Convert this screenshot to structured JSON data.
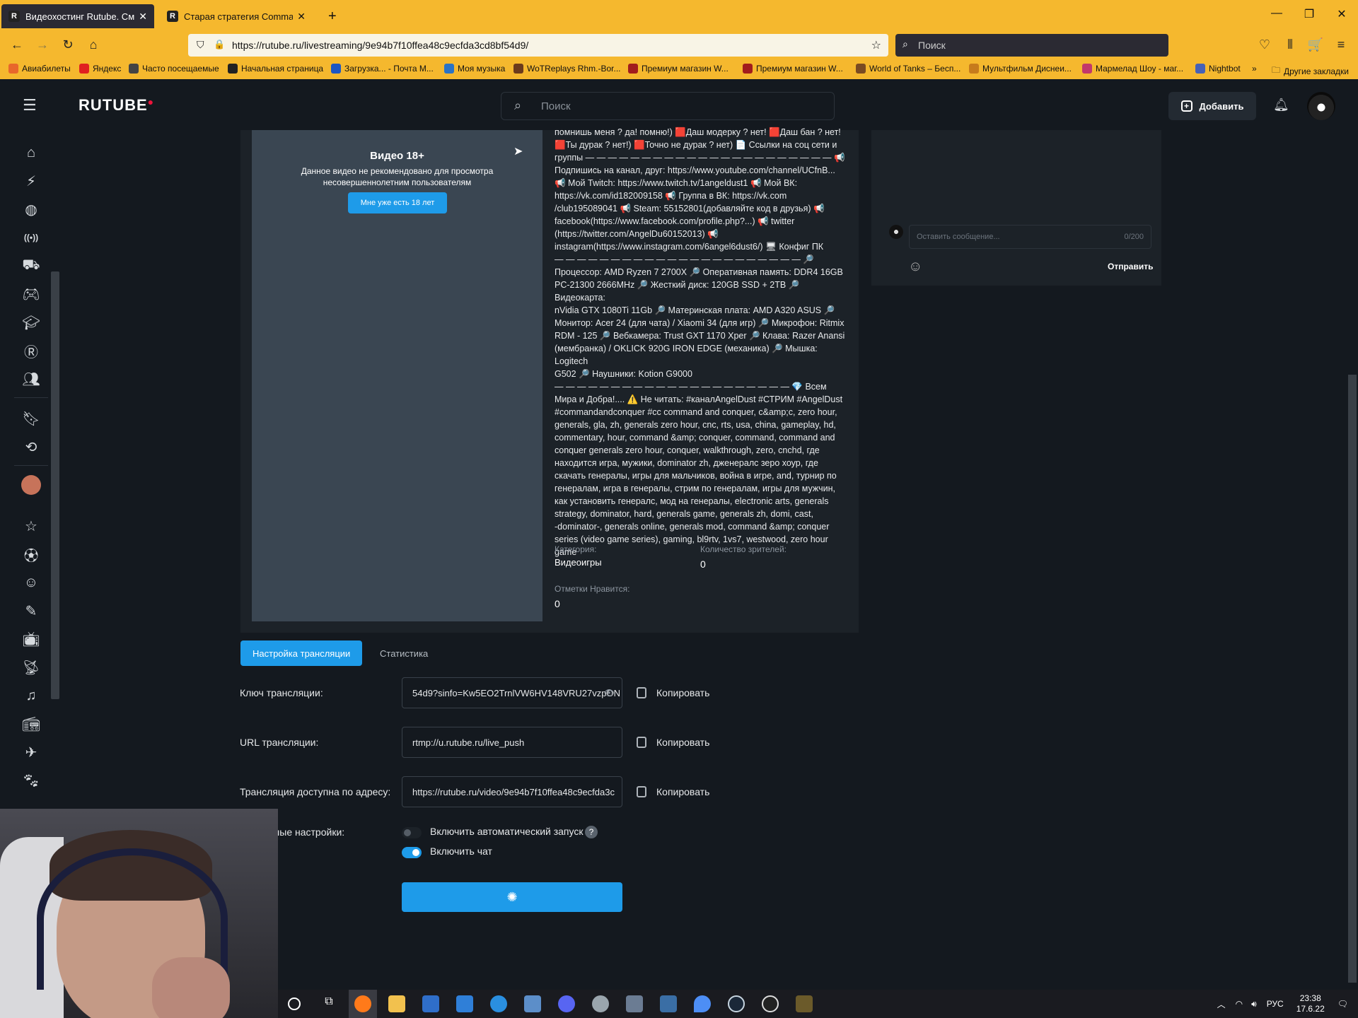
{
  "browser": {
    "tabs": [
      {
        "title": "Видеохостинг Rutube. Смотри",
        "favicon": "R",
        "active": true
      },
      {
        "title": "Старая стратегия Command a",
        "favicon": "R",
        "active": false
      }
    ],
    "new_tab": "+",
    "url": "https://rutube.ru/livestreaming/9e94b7f10ffea48c9ecfda3cd8bf54d9/",
    "search_placeholder": "Поиск",
    "bookmarks": [
      {
        "label": "Авиабилеты",
        "color": "#e8672b"
      },
      {
        "label": "Яндекс",
        "color": "#e02020"
      },
      {
        "label": "Часто посещаемые",
        "color": "#444444"
      },
      {
        "label": "Начальная страница",
        "color": "#222222"
      },
      {
        "label": "Загрузка... - Почта M...",
        "color": "#1d56c2"
      },
      {
        "label": "Моя музыка",
        "color": "#2a73c5"
      },
      {
        "label": "WoTReplays Rhm.-Bor...",
        "color": "#6b3b1c"
      },
      {
        "label": "Премиум магазин W...",
        "color": "#a11d1d"
      },
      {
        "label": "Премиум магазин W...",
        "color": "#a11d1d"
      },
      {
        "label": "World of Tanks – Бесп...",
        "color": "#7a4b22"
      },
      {
        "label": "Мультфильм Диснеи...",
        "color": "#c67b1c"
      },
      {
        "label": "Мармелад Шоу - маг...",
        "color": "#c2386b"
      },
      {
        "label": "Nightbot",
        "color": "#4661b6"
      }
    ],
    "other_bookmarks": "Другие закладки",
    "chevrons": "»"
  },
  "header": {
    "logo": "RUTUBE",
    "search_placeholder": "Поиск",
    "add_label": "Добавить"
  },
  "player": {
    "age_title": "Видео 18+",
    "age_desc": "Данное видео не рекомендовано для просмотра несовершеннолетним пользователям",
    "age_button": "Мне уже есть 18 лет"
  },
  "description": "помнишь меня ? да! помню!) 🟥Даш модерку ? нет! 🟥Даш бан ? нет!\n🟥Ты дурак ? нет!) 🟥Точно не дурак ? нет) 📄 Ссылки на соц сети и\nгруппы — — — — — — — — — — — — — — — — — — — — — — 📢\nПодпишись на канал, друг: https://www.youtube.com/channel/UCfnB...\n📢 Мой Twitch: https://www.twitch.tv/1angeldust1 📢 Мой ВК:\nhttps://vk.com/id182009158 📢 Группа в ВК: https://vk.com\n/club195089041 📢 Steam: 55152801(добавляйте код в друзья) 📢\nfacebook(https://www.facebook.com/profile.php?...) 📢 twitter\n(https://twitter.com/AngelDu60152013) 📢\ninstagram(https://www.instagram.com/6angel6dust6/) 🖥 Конфиг ПК\n— — — — — — — — — — — — — — — — — — — — — — 🔎\nПроцессор: AMD Ryzen 7 2700X 🔎 Оперативная память: DDR4 16GB\nPC-21300 2666MHz 🔎 Жесткий диск: 120GB SSD + 2TB 🔎 Видеокарта:\nnVidia GTX 1080Ti 11Gb 🔎 Материнская плата: AMD A320 ASUS 🔎\nМонитор: Acer 24 (для чата) / Xiaomi 34 (для игр) 🔎 Микрофон: Ritmix\nRDM - 125 🔎 Вебкамера: Trust GXT 1170 Xper 🔎 Клава: Razer Anansi\n(мембранка) / OKLICK 920G IRON EDGE (механика) 🔎 Мышка: Logitech\nG502 🔎 Наушники: Kotion G9000\n— — — — — — — — — — — — — — — — — — — — — 💎 Всем\nМира и Добра!.... ⚠️ Не читать: #каналAngelDust #СТРИМ #AngelDust\n#commandandconquer #cc command and conquer, c&amp;c, zero hour,\ngenerals, gla, zh, generals zero hour, cnc, rts, usa, china, gameplay, hd,\ncommentary, hour, command &amp; conquer, command, command and\nconquer generals zero hour, conquer, walkthrough, zero, cnchd, где\nнаходится игра, мужики, dominator zh, дженералс зеро хоур, где\nскачать генералы, игры для мальчиков, война в игре, and, турнир по\nгенералам, игра в генералы, стрим по генералам, игры для мужчин,\nкак установить генералс, мод на генералы, electronic arts, generals\nstrategy, dominator, hard, generals game, generals zh, domi, cast,\n-dominator-, generals online, generals mod, command &amp; conquer\nseries (video game series), gaming, bl9rtv, 1vs7, westwood, zero hour\ngame",
  "meta": {
    "category_label": "Категория:",
    "category_value": "Видеоигры",
    "viewers_label": "Количество зрителей:",
    "viewers_value": "0",
    "likes_label": "Отметки Нравится:",
    "likes_value": "0"
  },
  "chat": {
    "placeholder": "Оставить сообщение...",
    "counter": "0/200",
    "send_label": "Отправить"
  },
  "settings_tabs": {
    "broadcast": "Настройка трансляции",
    "stats": "Статистика"
  },
  "settings": {
    "key_label": "Ключ трансляции:",
    "key_value": "54d9?sinfo=Kw5EO2TrnlVW6HV148VRU27vzpON",
    "url_label": "URL трансляции:",
    "url_value": "rtmp://u.rutube.ru/live_push",
    "address_label": "Трансляция доступна по адресу:",
    "address_value": "https://rutube.ru/video/9e94b7f10ffea48c9ecfda3c",
    "copy_label": "Копировать",
    "extra_label": "...ительные настройки:",
    "autostart_label": "Включить автоматический запуск",
    "autostart_on": false,
    "chat_label": "Включить чат",
    "chat_on": true,
    "help": "?"
  },
  "taskbar": {
    "lang": "РУС",
    "time": "23:38",
    "date": "17.6.22"
  },
  "colors": {
    "accent": "#1e9be9",
    "browser_chrome": "#f5b82e",
    "background": "#14191f",
    "panel": "#1c2228",
    "logo_dot": "#ed143b"
  }
}
